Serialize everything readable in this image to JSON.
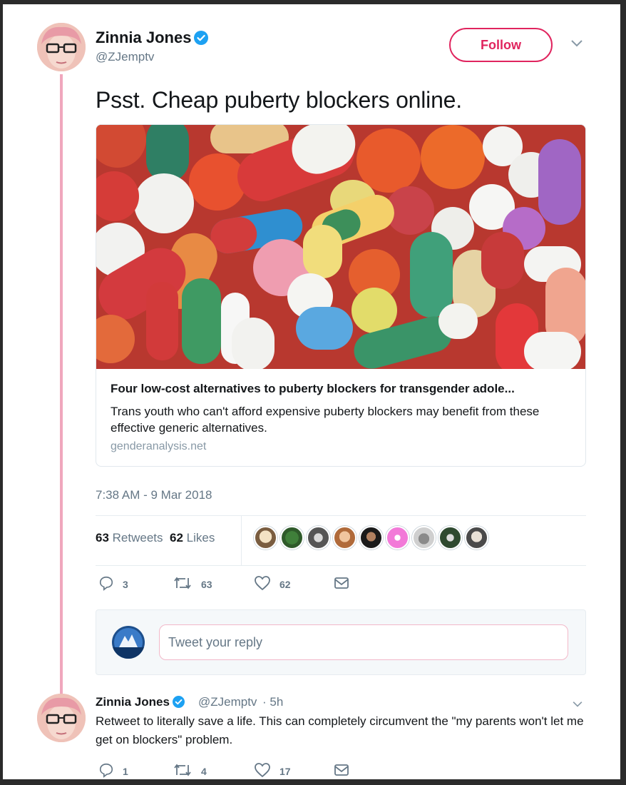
{
  "tweet": {
    "author_name": "Zinnia Jones",
    "author_handle": "@ZJemptv",
    "follow_label": "Follow",
    "text": "Psst. Cheap puberty blockers online.",
    "timestamp": "7:38 AM - 9 Mar 2018",
    "card": {
      "title": "Four low-cost alternatives to puberty blockers for transgender adole...",
      "description": "Trans youth who can't afford expensive puberty blockers may benefit from these effective generic alternatives.",
      "domain": "genderanalysis.net"
    },
    "stats": {
      "retweets_count": "63",
      "retweets_label": "Retweets",
      "likes_count": "62",
      "likes_label": "Likes"
    },
    "actions": {
      "replies": "3",
      "retweets": "63",
      "likes": "62"
    },
    "reply_placeholder": "Tweet your reply"
  },
  "reply_tweet": {
    "author_name": "Zinnia Jones",
    "author_handle": "@ZJemptv",
    "time": "· 5h",
    "text": "Retweet to literally save a life. This can completely circumvent the \"my parents won't let me get on blockers\" problem.",
    "actions": {
      "replies": "1",
      "retweets": "4",
      "likes": "17"
    }
  },
  "colors": {
    "follow_accent": "#e0245e",
    "verified_blue": "#1da1f2",
    "thread_line": "#f0a7bd",
    "secondary_text": "#657786"
  },
  "icons": [
    "verified-badge-icon",
    "chevron-down-icon",
    "reply-icon",
    "retweet-icon",
    "heart-icon",
    "envelope-icon"
  ]
}
